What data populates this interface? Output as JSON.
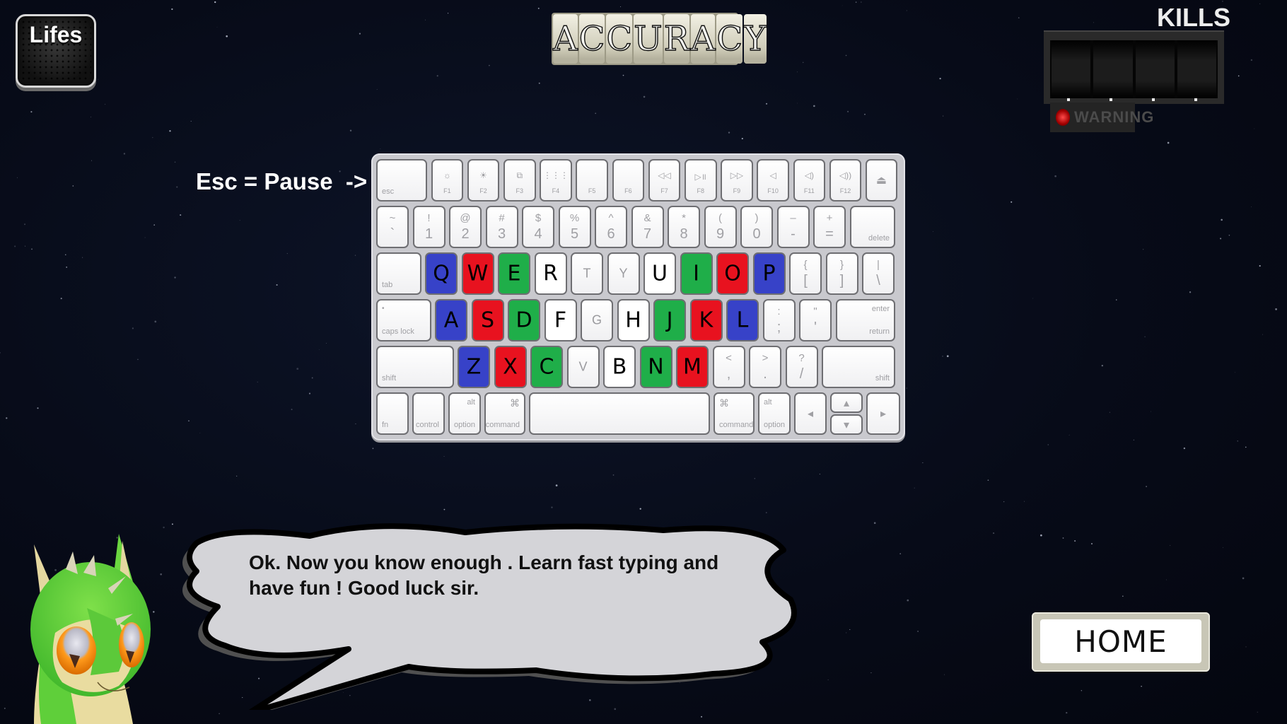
{
  "hud": {
    "lifes_label": "Lifes",
    "title_letters": [
      "A",
      "C",
      "C",
      "U",
      "R",
      "A",
      "C",
      "Y"
    ],
    "kills_label": "KILLS",
    "kills_reels": 4,
    "warning_label": "WARNING",
    "pause_hint": "Esc = Pause  ->"
  },
  "keyboard": {
    "colors": {
      "blue": "#3742c8",
      "red": "#e8121f",
      "green": "#1fae49",
      "white": "#ffffff"
    },
    "fn_row": [
      {
        "label": "esc",
        "icon": ""
      },
      {
        "label": "F1",
        "icon": "☼"
      },
      {
        "label": "F2",
        "icon": "☀"
      },
      {
        "label": "F3",
        "icon": "⧉"
      },
      {
        "label": "F4",
        "icon": "⋮⋮⋮"
      },
      {
        "label": "F5",
        "icon": ""
      },
      {
        "label": "F6",
        "icon": ""
      },
      {
        "label": "F7",
        "icon": "◁◁"
      },
      {
        "label": "F8",
        "icon": "▷॥"
      },
      {
        "label": "F9",
        "icon": "▷▷"
      },
      {
        "label": "F10",
        "icon": "◁"
      },
      {
        "label": "F11",
        "icon": "◁)"
      },
      {
        "label": "F12",
        "icon": "◁))"
      },
      {
        "label": "",
        "icon": "⏏"
      }
    ],
    "number_row": [
      {
        "top": "~",
        "bot": "`"
      },
      {
        "top": "!",
        "bot": "1"
      },
      {
        "top": "@",
        "bot": "2"
      },
      {
        "top": "#",
        "bot": "3"
      },
      {
        "top": "$",
        "bot": "4"
      },
      {
        "top": "%",
        "bot": "5"
      },
      {
        "top": "^",
        "bot": "6"
      },
      {
        "top": "&",
        "bot": "7"
      },
      {
        "top": "*",
        "bot": "8"
      },
      {
        "top": "(",
        "bot": "9"
      },
      {
        "top": ")",
        "bot": "0"
      },
      {
        "top": "–",
        "bot": "-"
      },
      {
        "top": "+",
        "bot": "="
      }
    ],
    "delete_label": "delete",
    "tab_label": "tab",
    "row_q": [
      {
        "key": "Q",
        "state": "blue"
      },
      {
        "key": "W",
        "state": "red"
      },
      {
        "key": "E",
        "state": "green"
      },
      {
        "key": "R",
        "state": "white"
      },
      {
        "key": "T",
        "state": "dim"
      },
      {
        "key": "Y",
        "state": "dim"
      },
      {
        "key": "U",
        "state": "white"
      },
      {
        "key": "I",
        "state": "green"
      },
      {
        "key": "O",
        "state": "red"
      },
      {
        "key": "P",
        "state": "blue"
      }
    ],
    "row_q_punct": [
      {
        "top": "{",
        "bot": "["
      },
      {
        "top": "}",
        "bot": "]"
      },
      {
        "top": "|",
        "bot": "\\"
      }
    ],
    "caps_label": "caps lock",
    "row_a": [
      {
        "key": "A",
        "state": "blue"
      },
      {
        "key": "S",
        "state": "red"
      },
      {
        "key": "D",
        "state": "green"
      },
      {
        "key": "F",
        "state": "white"
      },
      {
        "key": "G",
        "state": "dim"
      },
      {
        "key": "H",
        "state": "white"
      },
      {
        "key": "J",
        "state": "green"
      },
      {
        "key": "K",
        "state": "red"
      },
      {
        "key": "L",
        "state": "blue"
      }
    ],
    "row_a_punct": [
      {
        "top": ":",
        "bot": ";"
      },
      {
        "top": "\"",
        "bot": "'"
      }
    ],
    "enter_label": "enter",
    "return_label": "return",
    "shift_label": "shift",
    "row_z": [
      {
        "key": "Z",
        "state": "blue"
      },
      {
        "key": "X",
        "state": "red"
      },
      {
        "key": "C",
        "state": "green"
      },
      {
        "key": "V",
        "state": "dim"
      },
      {
        "key": "B",
        "state": "white"
      },
      {
        "key": "N",
        "state": "green"
      },
      {
        "key": "M",
        "state": "red"
      }
    ],
    "row_z_punct": [
      {
        "top": "<",
        "bot": ","
      },
      {
        "top": ">",
        "bot": "."
      },
      {
        "top": "?",
        "bot": "/"
      }
    ],
    "bottom_row": {
      "fn": "fn",
      "control": "control",
      "alt": "alt",
      "option": "option",
      "command_symbol": "⌘",
      "command": "command",
      "arrow_left": "◂",
      "arrow_up": "▴",
      "arrow_down": "▾",
      "arrow_right": "▸"
    }
  },
  "dialog": {
    "text": " Ok. Now you know enough . Learn fast typing and have fun ! Good luck sir."
  },
  "buttons": {
    "home_label": "HOME"
  }
}
